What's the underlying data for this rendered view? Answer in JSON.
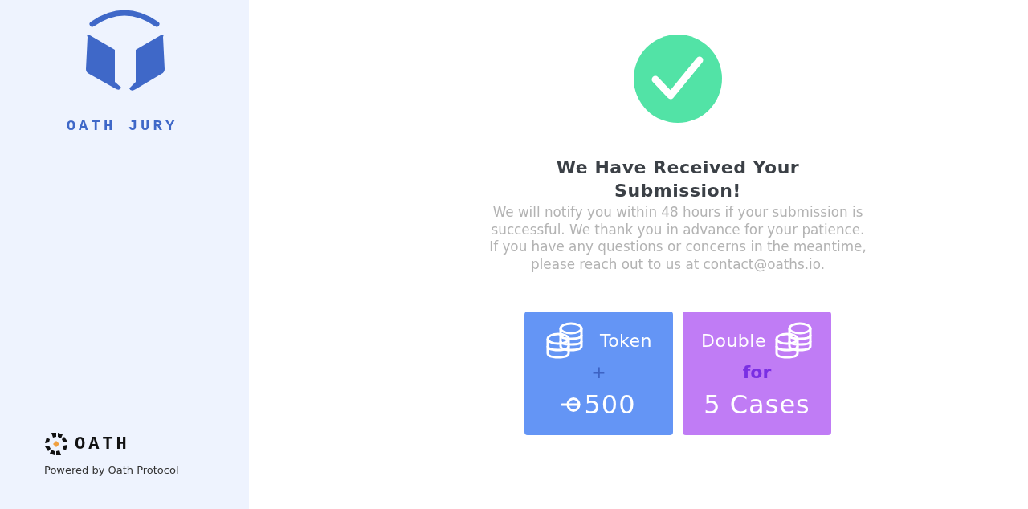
{
  "sidebar": {
    "logo_text": "OATH JURY",
    "footer": {
      "brand": "OATH",
      "powered_by": "Powered by Oath Protocol"
    }
  },
  "main": {
    "title": "We Have Received Your Submission!",
    "message": "We will notify you within 48 hours if your submission is successful. We thank you in advance for your patience. If you have any questions or concerns in the meantime, please reach out to us at contact@oaths.io.",
    "cards": [
      {
        "kind": "token",
        "color": "#6495f5",
        "label": "Token",
        "joiner": "+",
        "value": "500"
      },
      {
        "kind": "double",
        "color": "#c07cf5",
        "label": "Double",
        "joiner": "for",
        "value": "5 Cases"
      }
    ]
  }
}
